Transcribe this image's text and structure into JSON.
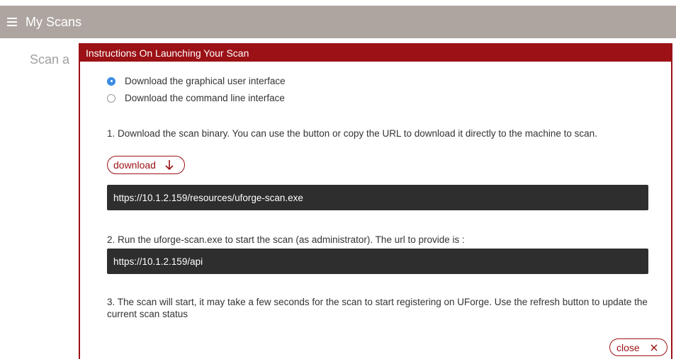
{
  "app": {
    "title": "My Scans"
  },
  "background": {
    "heading_fragment": "Scan a"
  },
  "modal": {
    "title": "Instructions On Launching Your Scan",
    "options": [
      {
        "label": "Download the graphical user interface",
        "selected": true
      },
      {
        "label": "Download the command line interface",
        "selected": false
      }
    ],
    "step1": "1. Download the scan binary. You can use the button or copy the URL to download it directly to the machine to scan.",
    "download_label": "download",
    "binary_url": "https://10.1.2.159/resources/uforge-scan.exe",
    "step2": "2. Run the uforge-scan.exe to start the scan (as administrator). The url to provide is :",
    "api_url": "https://10.1.2.159/api",
    "step3": "3. The scan will start, it may take a few seconds for the scan to start registering on UForge. Use the refresh button to update the current scan status",
    "close_label": "close"
  },
  "colors": {
    "accent": "#9b1116",
    "topbar": "#aea5a1",
    "radio_selected": "#3b8ce2",
    "code_bg": "#2e2e2e"
  },
  "icons": {
    "menu": "hamburger-icon",
    "download": "arrow-down-icon",
    "close": "close-icon"
  }
}
